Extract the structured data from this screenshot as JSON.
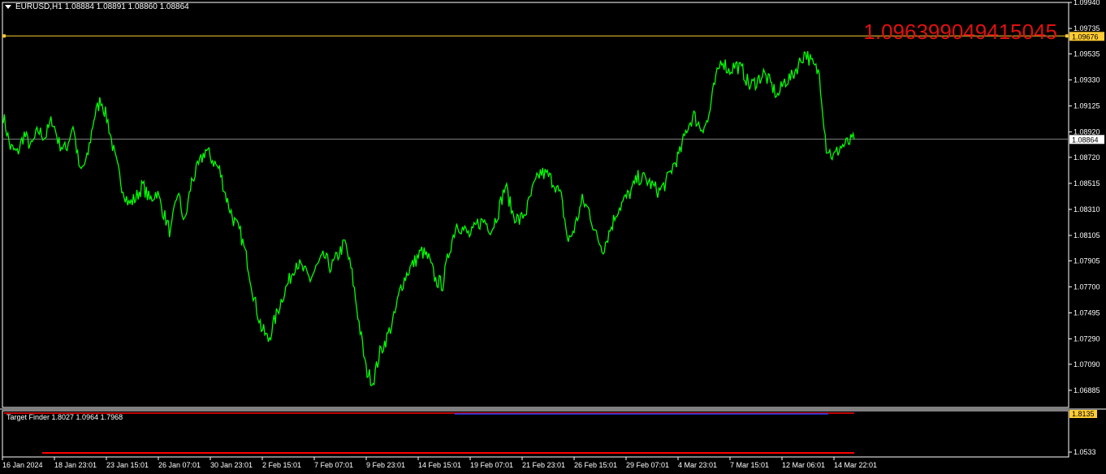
{
  "header": {
    "symbol": "EURUSD,H1",
    "ohlc": "1.08884 1.08891 1.08860 1.08864"
  },
  "indicator": {
    "label": "Target Finder 1.8027 1.0964 1.7968"
  },
  "annotation": "1.096399049415045",
  "colors": {
    "background": "#000000",
    "price_line": "#00ff00",
    "hline_yellow": "#ffcc33",
    "hline_bid": "#808080",
    "indicator_red": "#ff0000",
    "indicator_blue": "#2040ff",
    "annotation_red": "#e01010"
  },
  "chart_data": {
    "type": "line",
    "symbol": "EURUSD",
    "timeframe": "H1",
    "price_axis": {
      "range": [
        1.0675,
        1.0994
      ],
      "ticks": [
        "1.09940",
        "1.09735",
        "1.09535",
        "1.09330",
        "1.09125",
        "1.08920",
        "1.08720",
        "1.08515",
        "1.08310",
        "1.08105",
        "1.07905",
        "1.07700",
        "1.07495",
        "1.07290",
        "1.07090",
        "1.06885"
      ]
    },
    "time_axis_labels": [
      "16 Jan 2024",
      "18 Jan 23:01",
      "23 Jan 15:01",
      "26 Jan 07:01",
      "30 Jan 23:01",
      "2 Feb 15:01",
      "7 Feb 07:01",
      "9 Feb 23:01",
      "14 Feb 15:01",
      "19 Feb 07:01",
      "21 Feb 23:01",
      "26 Feb 15:01",
      "29 Feb 07:01",
      "4 Mar 23:01",
      "7 Mar 15:01",
      "12 Mar 06:01",
      "14 Mar 22:01"
    ],
    "series": [
      {
        "values": [
          [
            0,
            1.0905
          ],
          [
            1,
            1.088
          ],
          [
            2,
            1.0875
          ],
          [
            3,
            1.089
          ],
          [
            4,
            1.088
          ],
          [
            5,
            1.0893
          ],
          [
            6,
            1.0888
          ],
          [
            7,
            1.0902
          ],
          [
            8,
            1.0883
          ],
          [
            9,
            1.0878
          ],
          [
            10,
            1.0898
          ],
          [
            11,
            1.086
          ],
          [
            12,
            1.087
          ],
          [
            13,
            1.0903
          ],
          [
            14,
            1.0918
          ],
          [
            15,
            1.09
          ],
          [
            16,
            1.0872
          ],
          [
            17,
            1.085
          ],
          [
            18,
            1.0835
          ],
          [
            19,
            1.084
          ],
          [
            20,
            1.085
          ],
          [
            21,
            1.0838
          ],
          [
            22,
            1.0845
          ],
          [
            23,
            1.0828
          ],
          [
            24,
            1.0812
          ],
          [
            25,
            1.0845
          ],
          [
            26,
            1.082
          ],
          [
            27,
            1.0853
          ],
          [
            28,
            1.0865
          ],
          [
            29,
            1.0878
          ],
          [
            30,
            1.087
          ],
          [
            31,
            1.0862
          ],
          [
            32,
            1.084
          ],
          [
            33,
            1.0823
          ],
          [
            34,
            1.0812
          ],
          [
            35,
            1.079
          ],
          [
            36,
            1.076
          ],
          [
            37,
            1.0738
          ],
          [
            38,
            1.0728
          ],
          [
            39,
            1.0745
          ],
          [
            40,
            1.0762
          ],
          [
            41,
            1.0775
          ],
          [
            42,
            1.079
          ],
          [
            43,
            1.0783
          ],
          [
            44,
            1.0776
          ],
          [
            45,
            1.0786
          ],
          [
            46,
            1.0794
          ],
          [
            47,
            1.0785
          ],
          [
            48,
            1.0795
          ],
          [
            49,
            1.0805
          ],
          [
            50,
            1.078
          ],
          [
            51,
            1.0742
          ],
          [
            52,
            1.0705
          ],
          [
            53,
            1.0695
          ],
          [
            54,
            1.0718
          ],
          [
            55,
            1.073
          ],
          [
            56,
            1.0745
          ],
          [
            57,
            1.077
          ],
          [
            58,
            1.0782
          ],
          [
            59,
            1.079
          ],
          [
            60,
            1.0798
          ],
          [
            61,
            1.0792
          ],
          [
            62,
            1.0775
          ],
          [
            63,
            1.0772
          ],
          [
            64,
            1.08
          ],
          [
            65,
            1.082
          ],
          [
            66,
            1.0815
          ],
          [
            67,
            1.081
          ],
          [
            68,
            1.082
          ],
          [
            69,
            1.0822
          ],
          [
            70,
            1.0815
          ],
          [
            71,
            1.083
          ],
          [
            72,
            1.085
          ],
          [
            73,
            1.0828
          ],
          [
            74,
            1.0822
          ],
          [
            75,
            1.083
          ],
          [
            76,
            1.0848
          ],
          [
            77,
            1.086
          ],
          [
            78,
            1.0858
          ],
          [
            79,
            1.0852
          ],
          [
            80,
            1.084
          ],
          [
            81,
            1.0805
          ],
          [
            82,
            1.0818
          ],
          [
            83,
            1.0838
          ],
          [
            84,
            1.083
          ],
          [
            85,
            1.081
          ],
          [
            86,
            1.08
          ],
          [
            87,
            1.0815
          ],
          [
            88,
            1.083
          ],
          [
            89,
            1.0838
          ],
          [
            90,
            1.0845
          ],
          [
            91,
            1.0856
          ],
          [
            92,
            1.0855
          ],
          [
            93,
            1.085
          ],
          [
            94,
            1.0845
          ],
          [
            95,
            1.0852
          ],
          [
            96,
            1.0865
          ],
          [
            97,
            1.0875
          ],
          [
            98,
            1.0895
          ],
          [
            99,
            1.0905
          ],
          [
            100,
            1.0895
          ],
          [
            101,
            1.09
          ],
          [
            102,
            1.093
          ],
          [
            103,
            1.095
          ],
          [
            104,
            1.094
          ],
          [
            105,
            1.0945
          ],
          [
            106,
            1.094
          ],
          [
            107,
            1.0928
          ],
          [
            108,
            1.0932
          ],
          [
            109,
            1.0938
          ],
          [
            110,
            1.093
          ],
          [
            111,
            1.092
          ],
          [
            112,
            1.0932
          ],
          [
            113,
            1.0935
          ],
          [
            114,
            1.0945
          ],
          [
            115,
            1.0955
          ],
          [
            116,
            1.0945
          ],
          [
            117,
            1.0938
          ],
          [
            118,
            1.088
          ],
          [
            119,
            1.0872
          ],
          [
            120,
            1.088
          ],
          [
            121,
            1.0883
          ],
          [
            122,
            1.0886
          ]
        ]
      }
    ],
    "horizontal_lines": [
      {
        "price": 1.09676,
        "label": "1.09676"
      },
      {
        "price": 1.08864,
        "label": "1.08864"
      }
    ],
    "indicator_panel": {
      "name": "Target Finder",
      "axis_ticks": [
        "1.8135",
        "1.0533"
      ],
      "highlighted_tick": "1.8135"
    }
  }
}
